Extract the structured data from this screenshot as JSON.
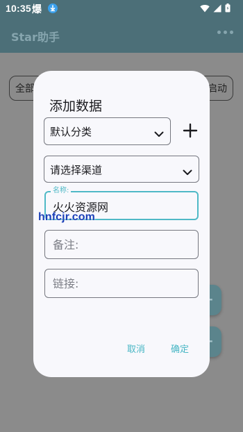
{
  "status_bar": {
    "time": "10:35",
    "notification_glyph": "爆",
    "icons": [
      "download-icon",
      "wifi-icon",
      "signal-icon",
      "battery-icon"
    ]
  },
  "app_bar": {
    "title": "Star助手",
    "more_icon": "more-horizontal-icon"
  },
  "background": {
    "chip_left": "全部",
    "chip_right": "启动",
    "fab_icon": "+"
  },
  "dialog": {
    "title": "添加数据",
    "category_select": {
      "value": "默认分类"
    },
    "add_category_icon": "plus-icon",
    "channel_select": {
      "placeholder": "请选择渠道"
    },
    "name_field": {
      "label": "名称:",
      "value": "火火资源网"
    },
    "note_field": {
      "placeholder": "备注:"
    },
    "link_field": {
      "placeholder": "链接:"
    },
    "cancel_label": "取消",
    "confirm_label": "确定"
  },
  "watermark": "hnfcjr.com",
  "colors": {
    "app_bar": "#4c6f78",
    "dialog_bg": "#f8f8fc",
    "accent": "#4fb9c6",
    "scrim_bg": "#8b8b8b"
  }
}
